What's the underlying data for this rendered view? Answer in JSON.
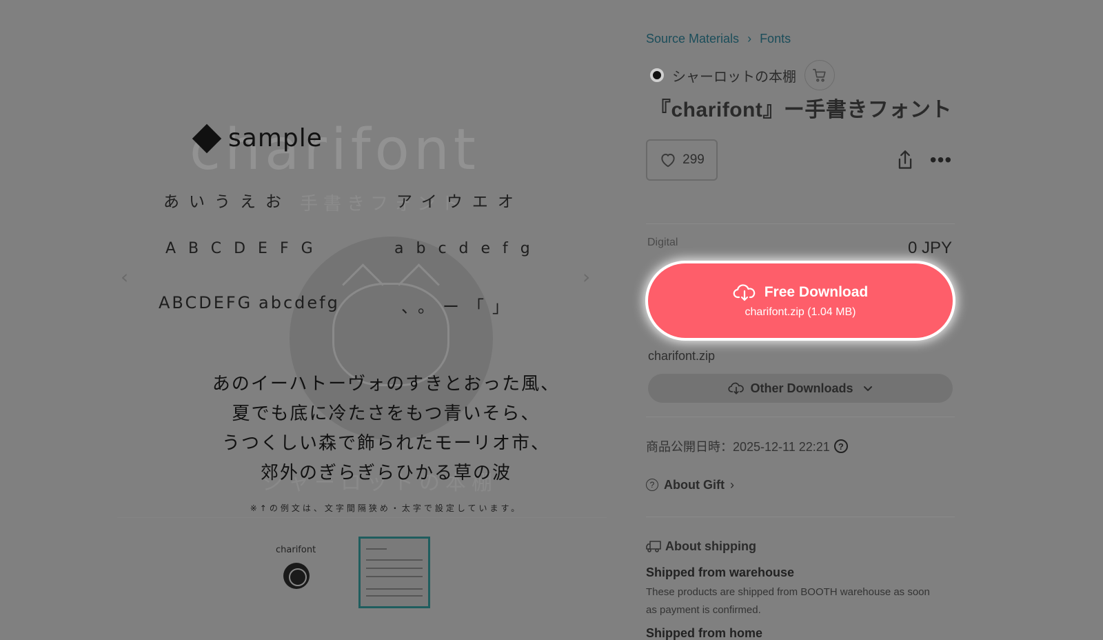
{
  "gallery": {
    "bg_title": "charifont",
    "bg_subtitle": "手書きフォント",
    "bg_author": "シャーロットの本棚",
    "sample_word": "sample",
    "rows": {
      "kana_hira": "あいうえお",
      "kana_kata": "アイウエオ",
      "upper": "ABCDEFG",
      "lower": "abcdefg",
      "upper_compact": "ABCDEFG",
      "lower_compact": "abcdefg",
      "punct": "、。ー「」"
    },
    "paragraph": [
      "あのイーハトーヴォのすきとおった風、",
      "夏でも底に冷たさをもつ青いそら、",
      "うつくしい森で飾られたモーリオ市、",
      "郊外のぎらぎらひかる草の波"
    ],
    "note": "※↑の例文は、文字間隔狭め・太字で設定しています。",
    "thumb_title": "charifont",
    "prev_icon": "chevron-left-icon",
    "next_icon": "chevron-right-icon"
  },
  "breadcrumb": [
    "Source Materials",
    "Fonts"
  ],
  "shop": {
    "name": "シャーロットの本棚"
  },
  "product": {
    "title": "『charifont』ー手書きフォント",
    "likes": "299"
  },
  "purchase": {
    "type_label": "Digital",
    "price": "0 JPY",
    "download_label": "Free Download",
    "download_file": "charifont.zip (1.04 MB)",
    "file_name": "charifont.zip",
    "other_downloads": "Other Downloads"
  },
  "info": {
    "published": "商品公開日時：2025-12-11 22:21",
    "about_gift": "About Gift",
    "about_shipping": "About shipping",
    "ship_heading": "Shipped from warehouse",
    "ship_text": "These products are shipped from BOOTH warehouse as soon as payment is confirmed.",
    "ship_heading_2": "Shipped from home"
  },
  "colors": {
    "accent": "#fe5e6a",
    "link": "#1b4d5a",
    "overlay": "#808080"
  }
}
